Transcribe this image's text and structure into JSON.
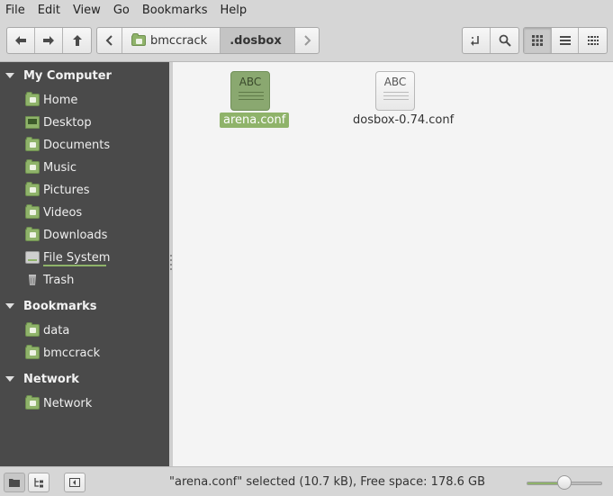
{
  "menubar": [
    "File",
    "Edit",
    "View",
    "Go",
    "Bookmarks",
    "Help"
  ],
  "path": {
    "parent": "bmccrack",
    "current": ".dosbox"
  },
  "sidebar": {
    "my_computer": {
      "title": "My Computer",
      "items": [
        "Home",
        "Desktop",
        "Documents",
        "Music",
        "Pictures",
        "Videos",
        "Downloads",
        "File System",
        "Trash"
      ]
    },
    "bookmarks": {
      "title": "Bookmarks",
      "items": [
        "data",
        "bmccrack"
      ]
    },
    "network": {
      "title": "Network",
      "items": [
        "Network"
      ]
    }
  },
  "files": [
    {
      "name": "arena.conf",
      "icon_text": "ABC",
      "selected": true
    },
    {
      "name": "dosbox-0.74.conf",
      "icon_text": "ABC",
      "selected": false
    }
  ],
  "status": {
    "text": "\"arena.conf\" selected (10.7 kB), Free space: 178.6 GB",
    "zoom_fraction": 0.5
  },
  "colors": {
    "accent": "#8fb36a",
    "sidebar_bg": "#4a4a4a",
    "main_bg": "#f4f4f4"
  }
}
